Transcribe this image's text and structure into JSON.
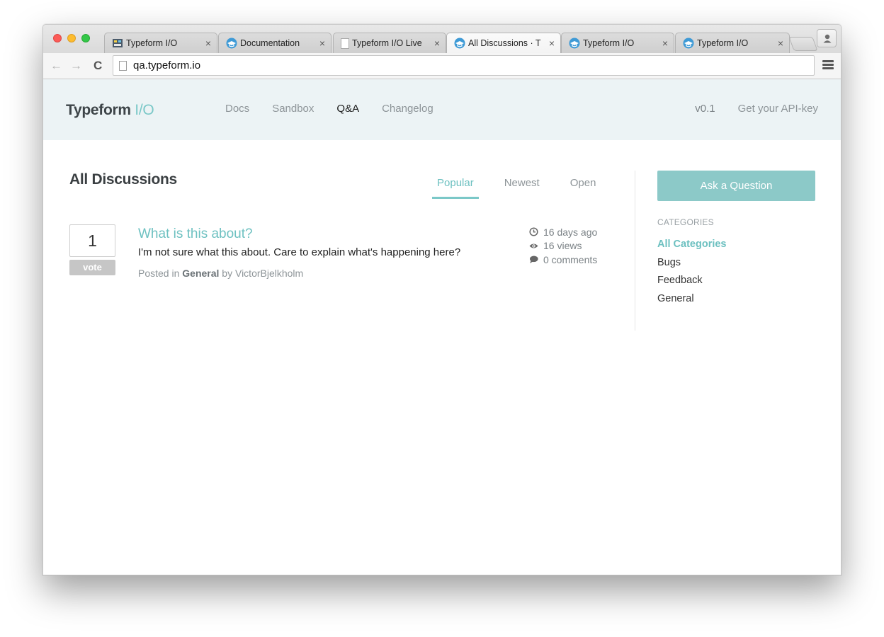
{
  "browser": {
    "tabs": [
      {
        "title": "Typeform I/O",
        "favicon": "typeform-io-favicon",
        "active": false
      },
      {
        "title": "Documentation",
        "favicon": "typeform-cap-favicon",
        "active": false
      },
      {
        "title": "Typeform I/O Live",
        "favicon": "blank-page-favicon",
        "active": false
      },
      {
        "title": "All Discussions · T",
        "favicon": "typeform-cap-favicon",
        "active": true
      },
      {
        "title": "Typeform I/O",
        "favicon": "typeform-cap-favicon",
        "active": false
      },
      {
        "title": "Typeform I/O",
        "favicon": "typeform-cap-favicon",
        "active": false
      }
    ],
    "tab_close_glyph": "×",
    "url": "qa.typeform.io",
    "back_glyph": "←",
    "forward_glyph": "→",
    "reload_glyph": "C"
  },
  "site": {
    "logo_text": "Typeform",
    "logo_accent": "I/O",
    "nav": [
      {
        "label": "Docs",
        "active": false
      },
      {
        "label": "Sandbox",
        "active": false
      },
      {
        "label": "Q&A",
        "active": true
      },
      {
        "label": "Changelog",
        "active": false
      }
    ],
    "version": "v0.1",
    "api_key_link": "Get your API-key"
  },
  "main": {
    "title": "All Discussions",
    "filters": [
      {
        "label": "Popular",
        "active": true
      },
      {
        "label": "Newest",
        "active": false
      },
      {
        "label": "Open",
        "active": false
      }
    ],
    "question": {
      "votes": "1",
      "vote_label": "vote",
      "title": "What is this about?",
      "excerpt": "I'm not sure what this about. Care to explain what's happening here?",
      "posted_in_prefix": "Posted in",
      "category": "General",
      "by_prefix": "by",
      "author": "VictorBjelkholm",
      "age": "16 days ago",
      "views": "16 views",
      "comments": "0 comments"
    }
  },
  "sidebar": {
    "ask_button": "Ask a Question",
    "categories_heading": "CATEGORIES",
    "categories": [
      {
        "label": "All Categories",
        "active": true
      },
      {
        "label": "Bugs",
        "active": false
      },
      {
        "label": "Feedback",
        "active": false
      },
      {
        "label": "General",
        "active": false
      }
    ]
  },
  "colors": {
    "accent": "#7bc8c8",
    "header_bg": "#ecf3f5",
    "ask_button_bg": "#8cc9c8"
  }
}
